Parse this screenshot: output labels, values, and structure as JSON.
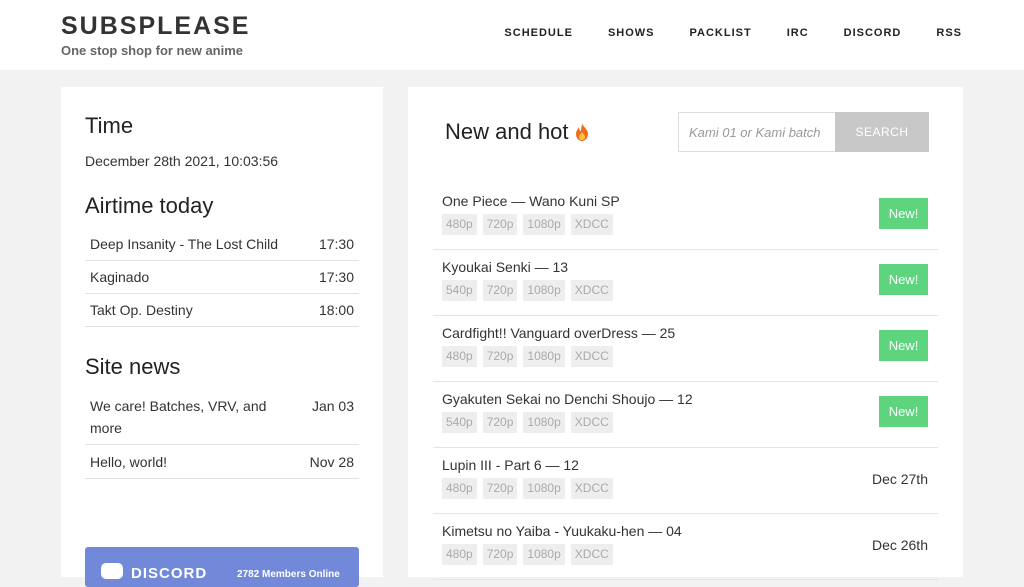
{
  "header": {
    "title": "SUBSPLEASE",
    "tagline": "One stop shop for new anime",
    "nav": [
      "SCHEDULE",
      "SHOWS",
      "PACKLIST",
      "IRC",
      "DISCORD",
      "RSS"
    ]
  },
  "sidebar": {
    "time_title": "Time",
    "time_value": "December 28th 2021, 10:03:56",
    "airtime_title": "Airtime today",
    "airtime": [
      {
        "show": "Deep Insanity - The Lost Child",
        "time": "17:30"
      },
      {
        "show": "Kaginado",
        "time": "17:30"
      },
      {
        "show": "Takt Op. Destiny",
        "time": "18:00"
      }
    ],
    "news_title": "Site news",
    "news": [
      {
        "title": "We care! Batches, VRV, and more",
        "date": "Jan 03"
      },
      {
        "title": "Hello, world!",
        "date": "Nov 28"
      }
    ],
    "discord": {
      "label": "DISCORD",
      "members": "2782 Members Online",
      "color": "#7289da"
    }
  },
  "main": {
    "title": "New and hot",
    "title_icon": "fire-icon",
    "search": {
      "placeholder": "Kami 01 or Kami batch",
      "button": "SEARCH"
    },
    "releases": [
      {
        "title": "One Piece — Wano Kuni SP",
        "qualities": [
          "480p",
          "720p",
          "1080p",
          "XDCC"
        ],
        "badge": "New!",
        "date": ""
      },
      {
        "title": "Kyoukai Senki — 13",
        "qualities": [
          "540p",
          "720p",
          "1080p",
          "XDCC"
        ],
        "badge": "New!",
        "date": ""
      },
      {
        "title": "Cardfight!! Vanguard overDress — 25",
        "qualities": [
          "480p",
          "720p",
          "1080p",
          "XDCC"
        ],
        "badge": "New!",
        "date": ""
      },
      {
        "title": "Gyakuten Sekai no Denchi Shoujo — 12",
        "qualities": [
          "540p",
          "720p",
          "1080p",
          "XDCC"
        ],
        "badge": "New!",
        "date": ""
      },
      {
        "title": "Lupin III - Part 6 — 12",
        "qualities": [
          "480p",
          "720p",
          "1080p",
          "XDCC"
        ],
        "badge": "",
        "date": "Dec 27th"
      },
      {
        "title": "Kimetsu no Yaiba - Yuukaku-hen — 04",
        "qualities": [
          "480p",
          "720p",
          "1080p",
          "XDCC"
        ],
        "badge": "",
        "date": "Dec 26th"
      }
    ],
    "badge_color": "#5fd47e"
  }
}
